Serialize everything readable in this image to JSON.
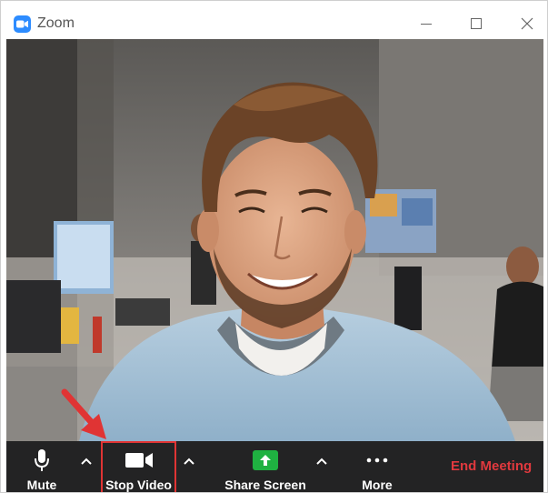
{
  "window": {
    "title": "Zoom",
    "app_icon": "zoom-logo-icon",
    "controls": [
      "minimize-icon",
      "maximize-icon",
      "close-icon"
    ]
  },
  "video": {
    "content": "participant-video-feed"
  },
  "toolbar": {
    "mute_label": "Mute",
    "stop_video_label": "Stop Video",
    "share_screen_label": "Share Screen",
    "more_label": "More",
    "end_meeting_label": "End Meeting",
    "icons": {
      "mute": "microphone-icon",
      "stop_video": "video-camera-icon",
      "share_screen": "share-screen-arrow-icon",
      "more": "ellipsis-icon",
      "caret": "chevron-up-icon"
    }
  },
  "annotation": {
    "highlighted_button": "Stop Video",
    "highlight_color": "#e03434"
  },
  "colors": {
    "toolbar_bg": "#232324",
    "end_meeting": "#e0393e",
    "share_green": "#1fb141",
    "zoom_blue": "#2d8cff"
  }
}
